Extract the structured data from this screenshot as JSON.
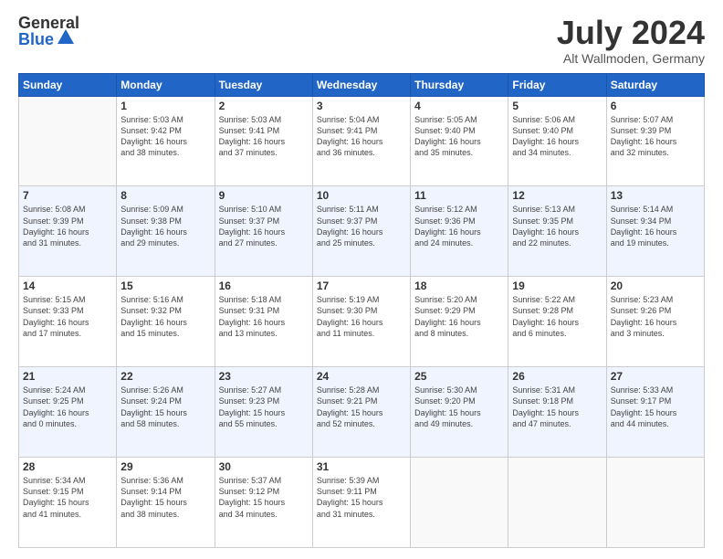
{
  "header": {
    "logo_general": "General",
    "logo_blue": "Blue",
    "month_title": "July 2024",
    "location": "Alt Wallmoden, Germany"
  },
  "days_of_week": [
    "Sunday",
    "Monday",
    "Tuesday",
    "Wednesday",
    "Thursday",
    "Friday",
    "Saturday"
  ],
  "weeks": [
    [
      {
        "day": "",
        "content": ""
      },
      {
        "day": "1",
        "content": "Sunrise: 5:03 AM\nSunset: 9:42 PM\nDaylight: 16 hours\nand 38 minutes."
      },
      {
        "day": "2",
        "content": "Sunrise: 5:03 AM\nSunset: 9:41 PM\nDaylight: 16 hours\nand 37 minutes."
      },
      {
        "day": "3",
        "content": "Sunrise: 5:04 AM\nSunset: 9:41 PM\nDaylight: 16 hours\nand 36 minutes."
      },
      {
        "day": "4",
        "content": "Sunrise: 5:05 AM\nSunset: 9:40 PM\nDaylight: 16 hours\nand 35 minutes."
      },
      {
        "day": "5",
        "content": "Sunrise: 5:06 AM\nSunset: 9:40 PM\nDaylight: 16 hours\nand 34 minutes."
      },
      {
        "day": "6",
        "content": "Sunrise: 5:07 AM\nSunset: 9:39 PM\nDaylight: 16 hours\nand 32 minutes."
      }
    ],
    [
      {
        "day": "7",
        "content": "Sunrise: 5:08 AM\nSunset: 9:39 PM\nDaylight: 16 hours\nand 31 minutes."
      },
      {
        "day": "8",
        "content": "Sunrise: 5:09 AM\nSunset: 9:38 PM\nDaylight: 16 hours\nand 29 minutes."
      },
      {
        "day": "9",
        "content": "Sunrise: 5:10 AM\nSunset: 9:37 PM\nDaylight: 16 hours\nand 27 minutes."
      },
      {
        "day": "10",
        "content": "Sunrise: 5:11 AM\nSunset: 9:37 PM\nDaylight: 16 hours\nand 25 minutes."
      },
      {
        "day": "11",
        "content": "Sunrise: 5:12 AM\nSunset: 9:36 PM\nDaylight: 16 hours\nand 24 minutes."
      },
      {
        "day": "12",
        "content": "Sunrise: 5:13 AM\nSunset: 9:35 PM\nDaylight: 16 hours\nand 22 minutes."
      },
      {
        "day": "13",
        "content": "Sunrise: 5:14 AM\nSunset: 9:34 PM\nDaylight: 16 hours\nand 19 minutes."
      }
    ],
    [
      {
        "day": "14",
        "content": "Sunrise: 5:15 AM\nSunset: 9:33 PM\nDaylight: 16 hours\nand 17 minutes."
      },
      {
        "day": "15",
        "content": "Sunrise: 5:16 AM\nSunset: 9:32 PM\nDaylight: 16 hours\nand 15 minutes."
      },
      {
        "day": "16",
        "content": "Sunrise: 5:18 AM\nSunset: 9:31 PM\nDaylight: 16 hours\nand 13 minutes."
      },
      {
        "day": "17",
        "content": "Sunrise: 5:19 AM\nSunset: 9:30 PM\nDaylight: 16 hours\nand 11 minutes."
      },
      {
        "day": "18",
        "content": "Sunrise: 5:20 AM\nSunset: 9:29 PM\nDaylight: 16 hours\nand 8 minutes."
      },
      {
        "day": "19",
        "content": "Sunrise: 5:22 AM\nSunset: 9:28 PM\nDaylight: 16 hours\nand 6 minutes."
      },
      {
        "day": "20",
        "content": "Sunrise: 5:23 AM\nSunset: 9:26 PM\nDaylight: 16 hours\nand 3 minutes."
      }
    ],
    [
      {
        "day": "21",
        "content": "Sunrise: 5:24 AM\nSunset: 9:25 PM\nDaylight: 16 hours\nand 0 minutes."
      },
      {
        "day": "22",
        "content": "Sunrise: 5:26 AM\nSunset: 9:24 PM\nDaylight: 15 hours\nand 58 minutes."
      },
      {
        "day": "23",
        "content": "Sunrise: 5:27 AM\nSunset: 9:23 PM\nDaylight: 15 hours\nand 55 minutes."
      },
      {
        "day": "24",
        "content": "Sunrise: 5:28 AM\nSunset: 9:21 PM\nDaylight: 15 hours\nand 52 minutes."
      },
      {
        "day": "25",
        "content": "Sunrise: 5:30 AM\nSunset: 9:20 PM\nDaylight: 15 hours\nand 49 minutes."
      },
      {
        "day": "26",
        "content": "Sunrise: 5:31 AM\nSunset: 9:18 PM\nDaylight: 15 hours\nand 47 minutes."
      },
      {
        "day": "27",
        "content": "Sunrise: 5:33 AM\nSunset: 9:17 PM\nDaylight: 15 hours\nand 44 minutes."
      }
    ],
    [
      {
        "day": "28",
        "content": "Sunrise: 5:34 AM\nSunset: 9:15 PM\nDaylight: 15 hours\nand 41 minutes."
      },
      {
        "day": "29",
        "content": "Sunrise: 5:36 AM\nSunset: 9:14 PM\nDaylight: 15 hours\nand 38 minutes."
      },
      {
        "day": "30",
        "content": "Sunrise: 5:37 AM\nSunset: 9:12 PM\nDaylight: 15 hours\nand 34 minutes."
      },
      {
        "day": "31",
        "content": "Sunrise: 5:39 AM\nSunset: 9:11 PM\nDaylight: 15 hours\nand 31 minutes."
      },
      {
        "day": "",
        "content": ""
      },
      {
        "day": "",
        "content": ""
      },
      {
        "day": "",
        "content": ""
      }
    ]
  ]
}
